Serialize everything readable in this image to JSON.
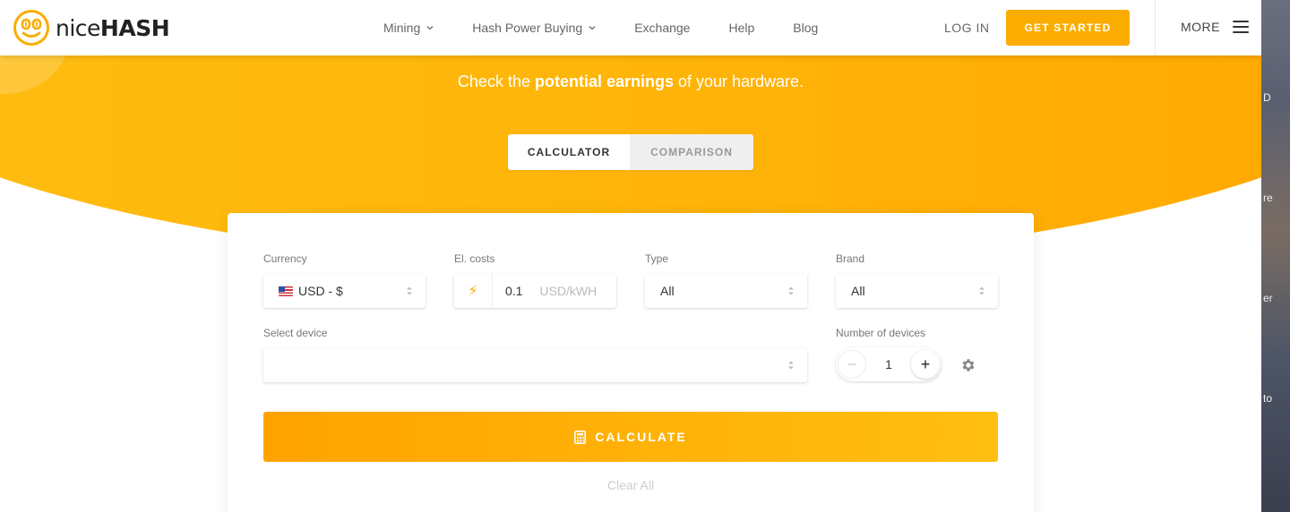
{
  "navbar": {
    "brand_light": "nice",
    "brand_bold": "HASH",
    "links": [
      {
        "label": "Mining",
        "has_dropdown": true
      },
      {
        "label": "Hash Power Buying",
        "has_dropdown": true
      },
      {
        "label": "Exchange",
        "has_dropdown": false
      },
      {
        "label": "Help",
        "has_dropdown": false
      },
      {
        "label": "Blog",
        "has_dropdown": false
      }
    ],
    "login_label": "LOG IN",
    "get_started_label": "GET STARTED",
    "more_label": "MORE"
  },
  "hero": {
    "tagline_pre": "Check the ",
    "tagline_bold": "potential earnings",
    "tagline_post": " of your hardware."
  },
  "tabs": [
    {
      "label": "CALCULATOR",
      "active": true
    },
    {
      "label": "COMPARISON",
      "active": false
    }
  ],
  "form": {
    "currency": {
      "label": "Currency",
      "value": "USD - $",
      "flag": "us-flag-icon"
    },
    "el_costs": {
      "label": "El. costs",
      "value": "0.1",
      "unit": "USD/kWH",
      "icon": "lightning-icon"
    },
    "type": {
      "label": "Type",
      "value": "All"
    },
    "brand": {
      "label": "Brand",
      "value": "All"
    },
    "select_device": {
      "label": "Select device",
      "value": ""
    },
    "number_of_devices": {
      "label": "Number of devices",
      "value": "1",
      "minus": "−",
      "plus": "+"
    },
    "calculate_label": "CALCULATE",
    "clear_label": "Clear All"
  },
  "side_strip": {
    "fragments": [
      "D",
      "re",
      "er",
      "to"
    ]
  },
  "colors": {
    "accent": "#fbac00",
    "hero_start": "#ffbe12",
    "hero_end": "#ffa600"
  }
}
